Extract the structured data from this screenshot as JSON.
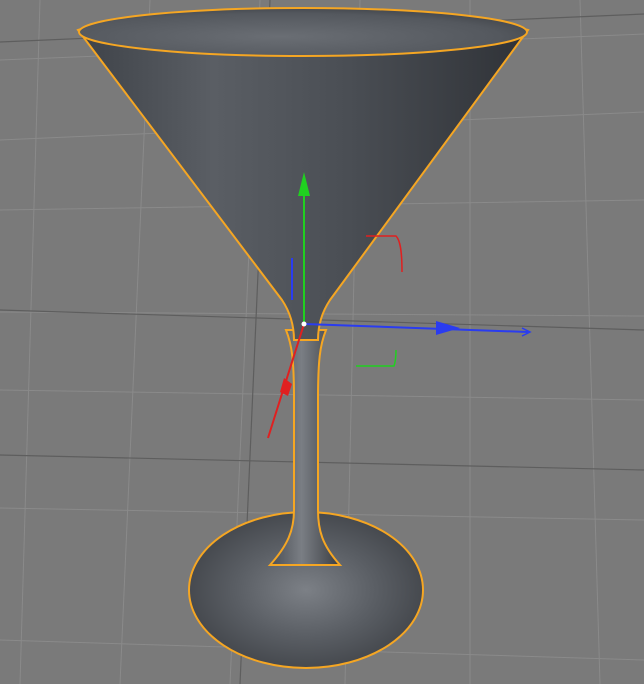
{
  "viewport": {
    "background_color": "#7a7a7a",
    "grid_line_color": "#8c8c8c",
    "grid_major_color": "#5e5e5e"
  },
  "scene": {
    "object": "martini-glass",
    "selected": true,
    "selection_outline_color": "#f5a623",
    "surface_color": "#50545a"
  },
  "gizmo": {
    "x_axis_color": "#e02020",
    "y_axis_color": "#20d020",
    "z_axis_color": "#2a3cf0"
  }
}
